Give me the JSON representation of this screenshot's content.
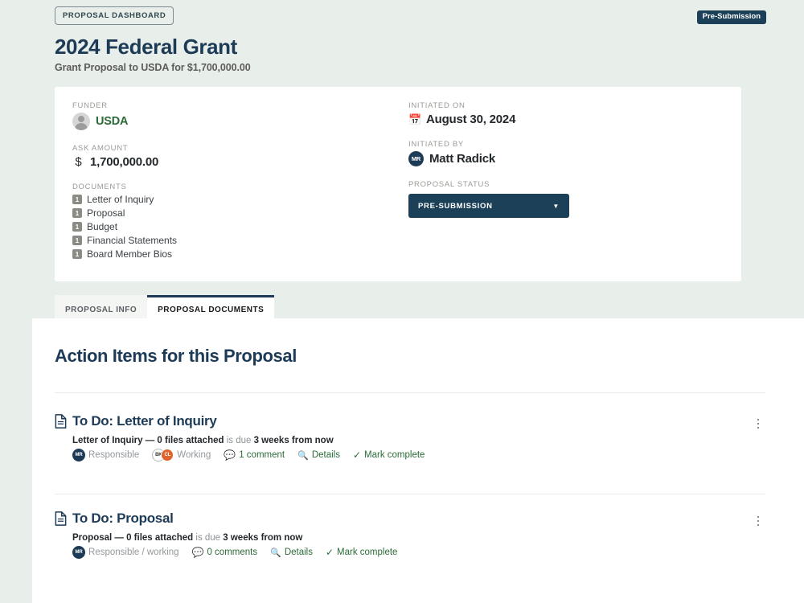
{
  "topbar": {
    "breadcrumb_label": "PROPOSAL DASHBOARD",
    "status_pill": "Pre-Submission"
  },
  "header": {
    "title": "2024 Federal Grant",
    "subtitle": "Grant Proposal to USDA for $1,700,000.00"
  },
  "summary": {
    "funder": {
      "label": "FUNDER",
      "value": "USDA",
      "avatar_icon": "generic-user-avatar-icon"
    },
    "ask_amount": {
      "label": "ASK AMOUNT",
      "currency_symbol": "$",
      "value": "1,700,000.00"
    },
    "documents": {
      "label": "DOCUMENTS",
      "items": [
        {
          "count": "1",
          "name": "Letter of Inquiry"
        },
        {
          "count": "1",
          "name": "Proposal"
        },
        {
          "count": "1",
          "name": "Budget"
        },
        {
          "count": "1",
          "name": "Financial Statements"
        },
        {
          "count": "1",
          "name": "Board Member Bios"
        }
      ]
    },
    "initiated_on": {
      "label": "INITIATED ON",
      "value": "August 30, 2024",
      "icon": "calendar-icon"
    },
    "initiated_by": {
      "label": "INITIATED BY",
      "value": "Matt Radick",
      "initials": "MR"
    },
    "proposal_status": {
      "label": "PROPOSAL STATUS",
      "selected": "PRE-SUBMISSION",
      "chevron": "▼"
    }
  },
  "tabs": [
    {
      "label": "PROPOSAL INFO",
      "active": false
    },
    {
      "label": "PROPOSAL DOCUMENTS",
      "active": true
    }
  ],
  "panel": {
    "title": "Action Items for this Proposal",
    "items": [
      {
        "title": "To Do: Letter of Inquiry",
        "meta_bold_1": "Letter of Inquiry — 0 files attached",
        "meta_plain": " is due ",
        "meta_bold_2": "3 weeks from now",
        "responsible_initials": "MR",
        "responsible_label": "Responsible",
        "working_initials_1": "BK",
        "working_initials_2": "CL",
        "working_label": "Working",
        "comments_label": "1 comment",
        "details_label": "Details",
        "complete_label": "Mark complete"
      },
      {
        "title": "To Do: Proposal",
        "meta_bold_1": "Proposal — 0 files attached",
        "meta_plain": " is due ",
        "meta_bold_2": "3 weeks from now",
        "responsible_initials": "MR",
        "responsible_label": "Responsible / working",
        "comments_label": "0 comments",
        "details_label": "Details",
        "complete_label": "Mark complete"
      }
    ]
  },
  "colors": {
    "page_bg": "#e8eeea",
    "navy": "#1d3b56",
    "navy_dark": "#1d4059",
    "green": "#2b6b38",
    "orange": "#e1622a"
  }
}
